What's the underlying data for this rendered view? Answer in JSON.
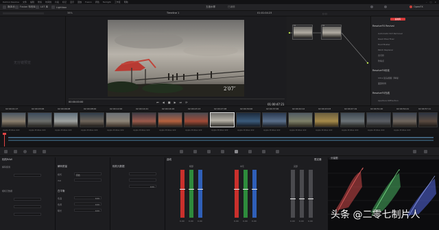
{
  "menubar": {
    "items": [
      "DaVinci Resolve",
      "文件",
      "编辑",
      "修剪",
      "时间线",
      "片段",
      "标记",
      "显示",
      "回放",
      "Fusion",
      "调色",
      "Fairlight",
      "工作区",
      "帮助"
    ]
  },
  "topbar": {
    "media_pool": "媒体池",
    "effects": "Fusion 特效库",
    "lut": "LUT 库",
    "project_title": "五渡水寨",
    "edited": "已编辑",
    "gallery": "画廊",
    "lightbox": "光箱",
    "nodes": "节点",
    "openfx": "OpenFX",
    "lightbox_label": "Lightbox"
  },
  "viewer": {
    "zoom": "38%",
    "timeline_name": "Timeline 1",
    "timecode_top": "01:01:04:23",
    "timecode_left": "00:00:00:00",
    "timecode_right": "01:00:47:21",
    "overlay": "2′07″",
    "nav_preview": "无分镜预览"
  },
  "nodes": {
    "n1": "01",
    "n2": "02"
  },
  "resolvefx": {
    "tab_label": "素材库",
    "sections": [
      {
        "title": "ResolveFX Revival",
        "items": [
          "Automatic Dirt Removal",
          "Dead Pixel Fixer",
          "Dust Buster",
          "Patch Replacer",
          "去闪烁",
          "防噪点",
          "去色带"
        ]
      },
      {
        "title": "ResolveFX优化",
        "items": [
          "Ultra 镜头模糊（降噪）",
          "面部修饰"
        ]
      },
      {
        "title": "ResolveFX光线",
        "items": [
          "Aperture Diffraction"
        ]
      }
    ]
  },
  "clips": {
    "timecodes": [
      "02:00:01:17",
      "02:00:03:06",
      "02:00:06:08",
      "02:00:08:00",
      "02:00:12:00",
      "02:00:14:21",
      "02:00:16:16",
      "02:00:23:13",
      "02:00:27:08",
      "02:00:30:00",
      "02:00:37:06",
      "02:00:40:12",
      "02:00:43:03",
      "02:00:47:19",
      "02:00:51:20",
      "02:00:54:21",
      "02:00:57:11"
    ],
    "labels": [
      "Apple ProRes 422",
      "Apple ProRes 422",
      "Apple ProRes 422",
      "Apple ProRes 422",
      "Apple ProRes 422",
      "Apple ProRes 422",
      "Apple ProRes 422",
      "Apple ProRes 422",
      "Apple ProRes 422",
      "Apple ProRes 422",
      "Apple ProRes 422",
      "Apple ProRes 422",
      "Apple ProRes 422",
      "Apple ProRes 422",
      "Apple ProRes 422",
      "Apple ProRes 422"
    ]
  },
  "lower": {
    "camera_raw": "相机RAW",
    "decode": "解码使用",
    "camera_meta": "相机元数据",
    "whitebalance": "白平衡",
    "color_temp": "色温",
    "tint": "色调",
    "exposure": "曝光",
    "decode_quality": "解码质量",
    "mode_label": "模式",
    "mode_value": "原始",
    "iso": "ISO",
    "lift": "暗部",
    "gamma": "中灰",
    "gain": "亮部",
    "curves": "曲线",
    "keyer": "限定器",
    "scope_title": "分量图",
    "values": {
      "a": "0.00",
      "b": "0.00",
      "c": "0.00",
      "d": "0.00"
    },
    "bar_values": [
      "0.00",
      "0.00",
      "0.00",
      "0.00",
      "0.00",
      "0.00",
      "0.00",
      "0.00",
      "0.00"
    ]
  },
  "watermark": "头条 @二零七制片人",
  "colors": {
    "accent_red": "#d63a3a",
    "red": "#c9302c",
    "green": "#2e8b3c",
    "blue": "#2f5fb8"
  }
}
